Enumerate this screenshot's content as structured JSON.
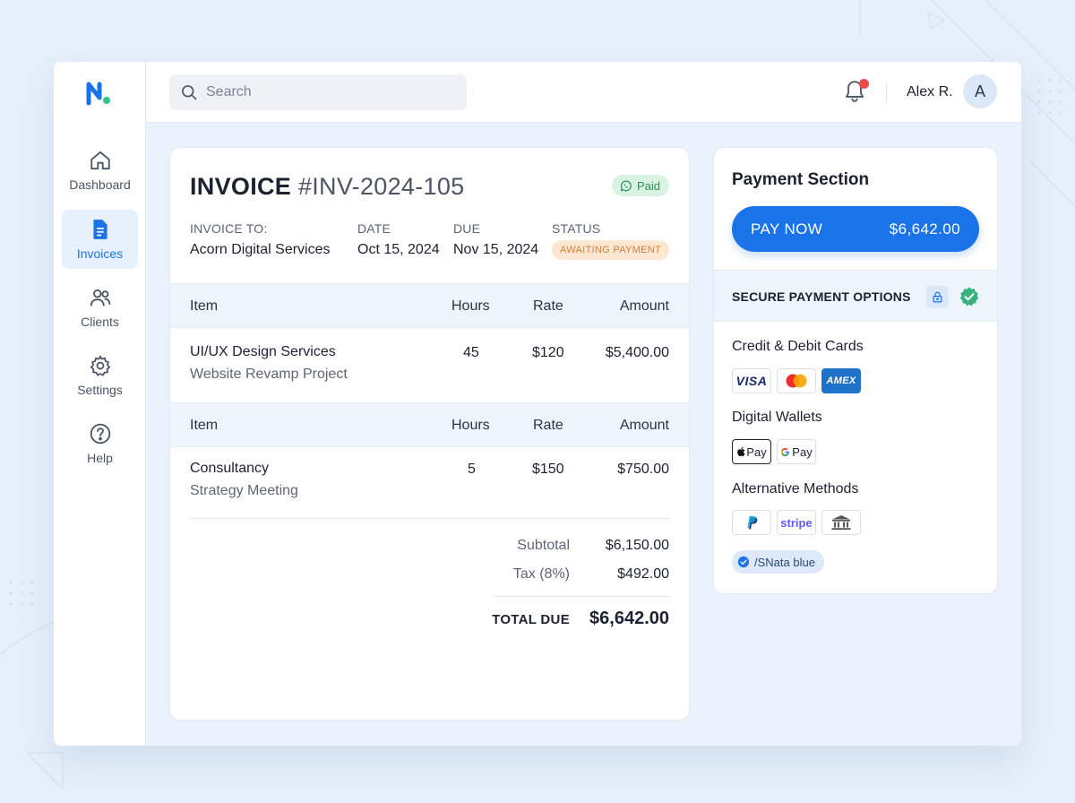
{
  "app": {
    "brand_icon": "n-logo"
  },
  "sidebar": {
    "items": [
      {
        "label": "Dashboard",
        "icon": "home-icon"
      },
      {
        "label": "Invoices",
        "icon": "document-icon",
        "active": true
      },
      {
        "label": "Clients",
        "icon": "users-icon"
      },
      {
        "label": "Settings",
        "icon": "gear-icon"
      },
      {
        "label": "Help",
        "icon": "help-icon"
      }
    ]
  },
  "topbar": {
    "search_placeholder": "Search",
    "user_name": "Alex R.",
    "avatar_initial": "A",
    "has_notification": true
  },
  "invoice": {
    "title": "INVOICE",
    "number": "#INV-2024-105",
    "paid_badge": "Paid",
    "meta": {
      "to_label": "INVOICE TO:",
      "to_value": "Acorn Digital Services",
      "date_label": "DATE",
      "date_value": "Oct 15, 2024",
      "due_label": "DUE",
      "due_value": "Nov 15, 2024",
      "status_label": "STATUS",
      "status_value": "AWAITING PAYMENT"
    },
    "columns": [
      "Item",
      "Hours",
      "Rate",
      "Amount"
    ],
    "items": [
      {
        "name": "UI/UX Design Services",
        "description": "Website Revamp Project",
        "hours": "45",
        "rate": "$120",
        "amount": "$5,400.00"
      },
      {
        "name": "Consultancy",
        "description": "Strategy Meeting",
        "hours": "5",
        "rate": "$150",
        "amount": "$750.00"
      }
    ],
    "subtotal_label": "Subtotal",
    "subtotal_value": "$6,150.00",
    "tax_label": "Tax (8%)",
    "tax_value": "$492.00",
    "total_label": "TOTAL DUE",
    "total_value": "$6,642.00"
  },
  "payment": {
    "title": "Payment Section",
    "pay_button_label": "PAY NOW",
    "pay_button_amount": "$6,642.00",
    "secure_label": "SECURE PAYMENT OPTIONS",
    "cards_title": "Credit & Debit Cards",
    "cards": [
      "VISA",
      "mastercard",
      "AMEX"
    ],
    "wallets_title": "Digital Wallets",
    "wallets": [
      "Pay",
      "Pay"
    ],
    "alternatives_title": "Alternative Methods",
    "alternatives": [
      "paypal",
      "stripe",
      "bank"
    ],
    "extra_badge": "/SNata blue"
  },
  "colors": {
    "accent": "#1a73e8",
    "paid": "#2f8f57",
    "awaiting": "#d2803b",
    "notification": "#ef4b4b"
  }
}
